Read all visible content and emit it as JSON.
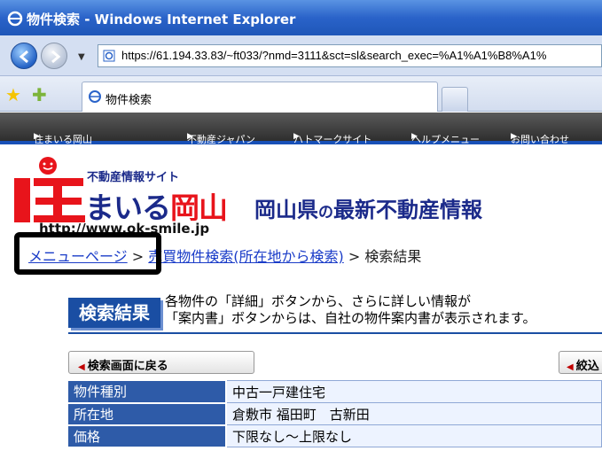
{
  "window": {
    "title": "物件検索 - Windows Internet Explorer"
  },
  "address": {
    "url": "https://61.194.33.83/~ft033/?nmd=3111&sct=sl&search_exec=%A1%A1%B8%A1%"
  },
  "tab": {
    "label": "物件検索"
  },
  "site_nav": {
    "items": [
      "住まいる岡山",
      "不動産ジャパン",
      "ハトマークサイト",
      "ヘルプメニュー",
      "お問い合わせ"
    ]
  },
  "header": {
    "logo_sub": "不動産情報サイト",
    "logo_main_a": "まいる",
    "logo_main_b": "岡山",
    "headline_a": "岡山県",
    "headline_b": "の",
    "headline_c": "最新不動産情報",
    "site_url": "http://www.ok-smile.jp"
  },
  "breadcrumb": {
    "menu": "メニューページ",
    "sep1": ">",
    "search": "売買物件検索(所在地から検索)",
    "sep2": ">",
    "current": "検索結果"
  },
  "section": {
    "badge": "検索結果",
    "line1": "各物件の「詳細」ボタンから、さらに詳しい情報が",
    "line2": "「案内書」ボタンからは、自社の物件案内書が表示されます。"
  },
  "buttons": {
    "back": "検索画面に戻る",
    "narrow": "絞込"
  },
  "table": {
    "rows": [
      {
        "k": "物件種別",
        "v": "中古一戸建住宅"
      },
      {
        "k": "所在地",
        "v": "倉敷市 福田町　古新田"
      },
      {
        "k": "価格",
        "v": "下限なし～上限なし"
      }
    ]
  }
}
